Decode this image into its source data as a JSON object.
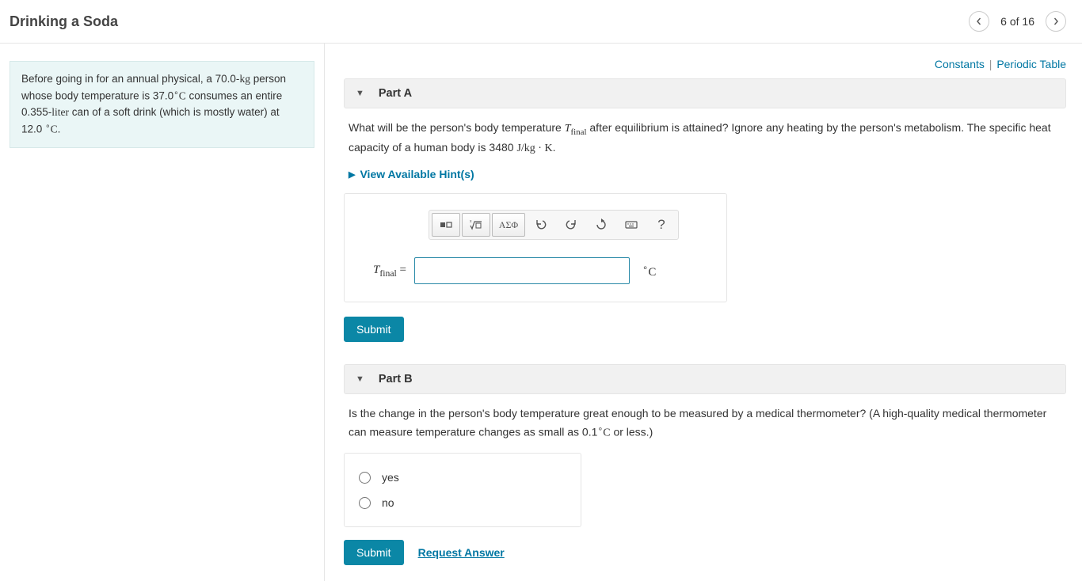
{
  "header": {
    "title": "Drinking a Soda",
    "nav": {
      "pos": "6 of 16"
    }
  },
  "prompt": {
    "before": "Before going in for an annual physical, a 70.0-",
    "mass_unit": "kg",
    "mid1": " person whose body temperature is 37.0",
    "deg": "∘",
    "c": "C",
    "mid2": " consumes an entire 0.355-",
    "vol_unit": "liter",
    "mid3": " can of a soft drink (which is mostly water) at 12.0 ",
    "end": "."
  },
  "resources": {
    "constants": "Constants",
    "periodic": "Periodic Table"
  },
  "partA": {
    "label": "Part A",
    "q_before": "What will be the person's body temperature ",
    "q_var": "T",
    "q_sub": "final",
    "q_after": " after equilibrium is attained? Ignore any heating by the person's metabolism. The specific heat capacity of a human body is 3480 ",
    "q_units": "J/kg · K",
    "q_end": ".",
    "hints": "View Available Hint(s)",
    "eq_var": "T",
    "eq_sub": "final",
    "eq_eq": " = ",
    "unit_deg": "∘",
    "unit_c": "C",
    "submit": "Submit",
    "toolbar": {
      "greek": "ΑΣΦ",
      "help": "?"
    }
  },
  "partB": {
    "label": "Part B",
    "q1": "Is the change in the person's body temperature great enough to be measured by a medical thermometer? (A high-quality medical thermometer can measure temperature changes as small as 0.1",
    "deg": "∘",
    "c": "C",
    "q2": " or less.)",
    "opt_yes": "yes",
    "opt_no": "no",
    "submit": "Submit",
    "request": "Request Answer"
  }
}
